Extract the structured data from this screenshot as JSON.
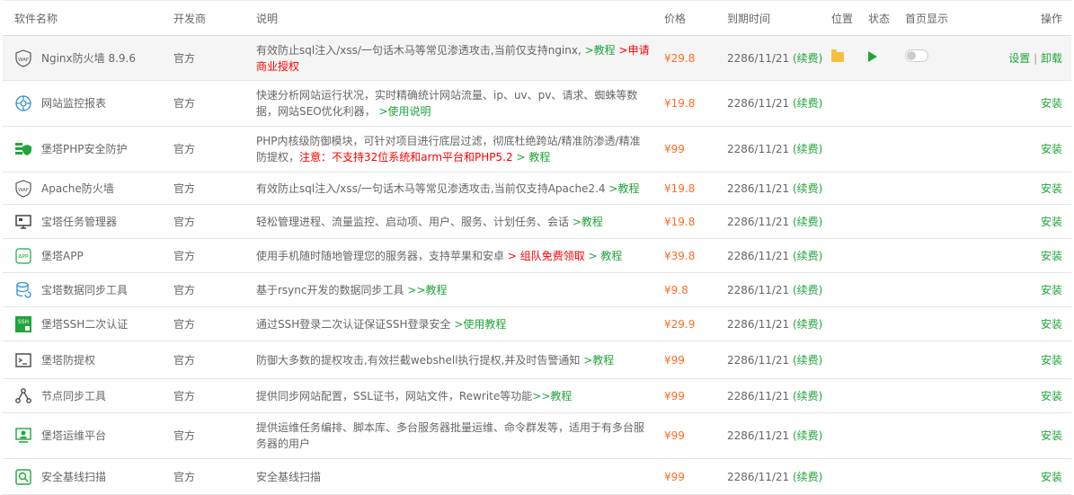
{
  "header": {
    "name": "软件名称",
    "developer": "开发商",
    "description": "说明",
    "price": "价格",
    "expire": "到期时间",
    "location": "位置",
    "status": "状态",
    "homepage": "首页显示",
    "operation": "操作"
  },
  "rows": [
    {
      "name": "Nginx防火墙 8.9.6",
      "icon": "waf-icon",
      "developer": "官方",
      "desc": "有效防止sql注入/xss/一句话木马等常见渗透攻击,当前仅支持nginx,",
      "link1": ">教程",
      "link2": ">申请商业授权",
      "price": "¥29.8",
      "date": "2286/11/21",
      "renew": "(续费)",
      "op1": "设置",
      "sep": "|",
      "op2": "卸载"
    },
    {
      "name": "网站监控报表",
      "icon": "monitor-icon",
      "developer": "官方",
      "desc": "快速分析网站运行状况，实时精确统计网站流量、ip、uv、pv、请求、蜘蛛等数据，网站SEO优化利器，",
      "link1": ">使用说明",
      "price": "¥19.8",
      "date": "2286/11/21",
      "renew": "(续费)",
      "op": "安装"
    },
    {
      "name": "堡塔PHP安全防护",
      "icon": "php-guard-icon",
      "developer": "官方",
      "desc": "PHP内核级防御模块，可针对项目进行底层过滤，彻底杜绝跨站/精准防渗透/精准防提权，",
      "warn": "注意：不支持32位系统和arm平台和PHP5.2",
      "link1": "> 教程",
      "price": "¥99",
      "date": "2286/11/21",
      "renew": "(续费)",
      "op": "安装"
    },
    {
      "name": "Apache防火墙",
      "icon": "waf-icon",
      "developer": "官方",
      "desc": "有效防止sql注入/xss/一句话木马等常见渗透攻击,当前仅支持Apache2.4",
      "link1": ">教程",
      "price": "¥19.8",
      "date": "2286/11/21",
      "renew": "(续费)",
      "op": "安装"
    },
    {
      "name": "宝塔任务管理器",
      "icon": "task-manager-icon",
      "developer": "官方",
      "desc": "轻松管理进程、流量监控、启动项、用户、服务、计划任务、会话",
      "link1": ">教程",
      "price": "¥19.8",
      "date": "2286/11/21",
      "renew": "(续费)",
      "op": "安装"
    },
    {
      "name": "堡塔APP",
      "icon": "app-icon",
      "developer": "官方",
      "desc": "使用手机随时随地管理您的服务器，支持苹果和安卓",
      "link2": "> 组队免费领取",
      "link1": "> 教程",
      "price": "¥39.8",
      "date": "2286/11/21",
      "renew": "(续费)",
      "op": "安装"
    },
    {
      "name": "宝塔数据同步工具",
      "icon": "database-sync-icon",
      "developer": "官方",
      "desc": "基于rsync开发的数据同步工具",
      "link1": ">>教程",
      "price": "¥9.8",
      "date": "2286/11/21",
      "renew": "(续费)",
      "op": "安装"
    },
    {
      "name": "堡塔SSH二次认证",
      "icon": "ssh-icon",
      "developer": "官方",
      "desc": "通过SSH登录二次认证保证SSH登录安全",
      "link1": ">使用教程",
      "price": "¥29.9",
      "date": "2286/11/21",
      "renew": "(续费)",
      "op": "安装"
    },
    {
      "name": "堡塔防提权",
      "icon": "terminal-icon",
      "developer": "官方",
      "desc": "防御大多数的提权攻击,有效拦截webshell执行提权,并及时告警通知",
      "link1": ">教程",
      "price": "¥99",
      "date": "2286/11/21",
      "renew": "(续费)",
      "op": "安装"
    },
    {
      "name": "节点同步工具",
      "icon": "node-sync-icon",
      "developer": "官方",
      "desc": "提供同步网站配置，SSL证书，网站文件，Rewrite等功能",
      "link1": ">>教程",
      "price": "¥99",
      "date": "2286/11/21",
      "renew": "(续费)",
      "op": "安装"
    },
    {
      "name": "堡塔运维平台",
      "icon": "ops-platform-icon",
      "developer": "官方",
      "desc": "提供运维任务编排、脚本库、多台服务器批量运维、命令群发等，适用于有多台服务器的用户",
      "price": "¥99",
      "date": "2286/11/21",
      "renew": "(续费)",
      "op": "安装"
    },
    {
      "name": "安全基线扫描",
      "icon": "baseline-scan-icon",
      "developer": "官方",
      "desc": "安全基线扫描",
      "price": "¥99",
      "date": "2286/11/21",
      "renew": "(续费)",
      "op": "安装"
    }
  ]
}
